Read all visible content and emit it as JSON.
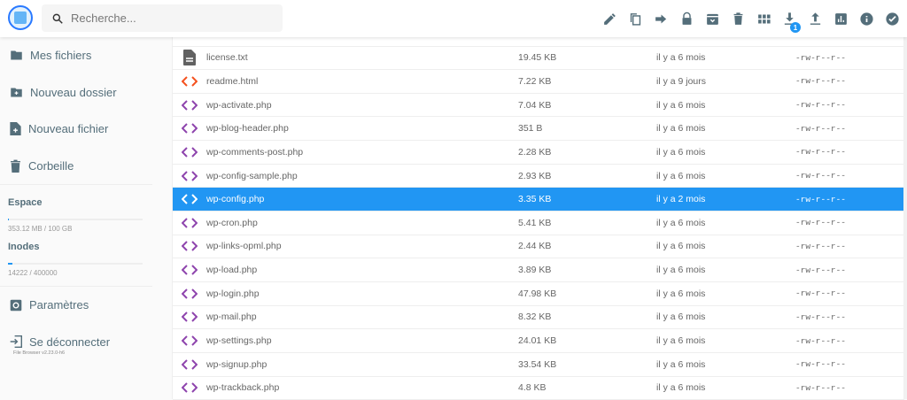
{
  "header": {
    "search_placeholder": "Recherche...",
    "download_badge": "1",
    "tools": [
      "edit-icon",
      "copy-icon",
      "move-icon",
      "lock-icon",
      "archive-icon",
      "delete-icon",
      "grid-view-icon",
      "download-icon",
      "upload-icon",
      "info-chart-icon",
      "info-icon",
      "select-icon"
    ]
  },
  "sidebar": {
    "items": [
      {
        "label": "Mes fichiers"
      },
      {
        "label": "Nouveau dossier"
      },
      {
        "label": "Nouveau fichier"
      },
      {
        "label": "Corbeille"
      }
    ],
    "quota": {
      "space_label": "Espace",
      "space_text": "353.12 MB / 100 GB",
      "space_fraction": 0.0035,
      "inodes_label": "Inodes",
      "inodes_text": "14222 / 400000",
      "inodes_fraction": 0.0356
    },
    "settings": "Paramètres",
    "logout": "Se déconnecter",
    "version": "File Browser v2.23.0-h6"
  },
  "files": [
    {
      "name": "license.txt",
      "size": "19.45 KB",
      "date": "il y a 6 mois",
      "perm": "-rw-r--r--",
      "type": "text"
    },
    {
      "name": "readme.html",
      "size": "7.22 KB",
      "date": "il y a 9 jours",
      "perm": "-rw-r--r--",
      "type": "html"
    },
    {
      "name": "wp-activate.php",
      "size": "7.04 KB",
      "date": "il y a 6 mois",
      "perm": "-rw-r--r--",
      "type": "php"
    },
    {
      "name": "wp-blog-header.php",
      "size": "351 B",
      "date": "il y a 6 mois",
      "perm": "-rw-r--r--",
      "type": "php"
    },
    {
      "name": "wp-comments-post.php",
      "size": "2.28 KB",
      "date": "il y a 6 mois",
      "perm": "-rw-r--r--",
      "type": "php"
    },
    {
      "name": "wp-config-sample.php",
      "size": "2.93 KB",
      "date": "il y a 6 mois",
      "perm": "-rw-r--r--",
      "type": "php"
    },
    {
      "name": "wp-config.php",
      "size": "3.35 KB",
      "date": "il y a 2 mois",
      "perm": "-rw-r--r--",
      "type": "php",
      "selected": true
    },
    {
      "name": "wp-cron.php",
      "size": "5.41 KB",
      "date": "il y a 6 mois",
      "perm": "-rw-r--r--",
      "type": "php"
    },
    {
      "name": "wp-links-opml.php",
      "size": "2.44 KB",
      "date": "il y a 6 mois",
      "perm": "-rw-r--r--",
      "type": "php"
    },
    {
      "name": "wp-load.php",
      "size": "3.89 KB",
      "date": "il y a 6 mois",
      "perm": "-rw-r--r--",
      "type": "php"
    },
    {
      "name": "wp-login.php",
      "size": "47.98 KB",
      "date": "il y a 6 mois",
      "perm": "-rw-r--r--",
      "type": "php"
    },
    {
      "name": "wp-mail.php",
      "size": "8.32 KB",
      "date": "il y a 6 mois",
      "perm": "-rw-r--r--",
      "type": "php"
    },
    {
      "name": "wp-settings.php",
      "size": "24.01 KB",
      "date": "il y a 6 mois",
      "perm": "-rw-r--r--",
      "type": "php"
    },
    {
      "name": "wp-signup.php",
      "size": "33.54 KB",
      "date": "il y a 6 mois",
      "perm": "-rw-r--r--",
      "type": "php"
    },
    {
      "name": "wp-trackback.php",
      "size": "4.8 KB",
      "date": "il y a 6 mois",
      "perm": "-rw-r--r--",
      "type": "php"
    }
  ],
  "colors": {
    "accent": "#2196f3",
    "php": "#8e44ad",
    "html": "#f4511e",
    "icon": "#546e7a"
  }
}
